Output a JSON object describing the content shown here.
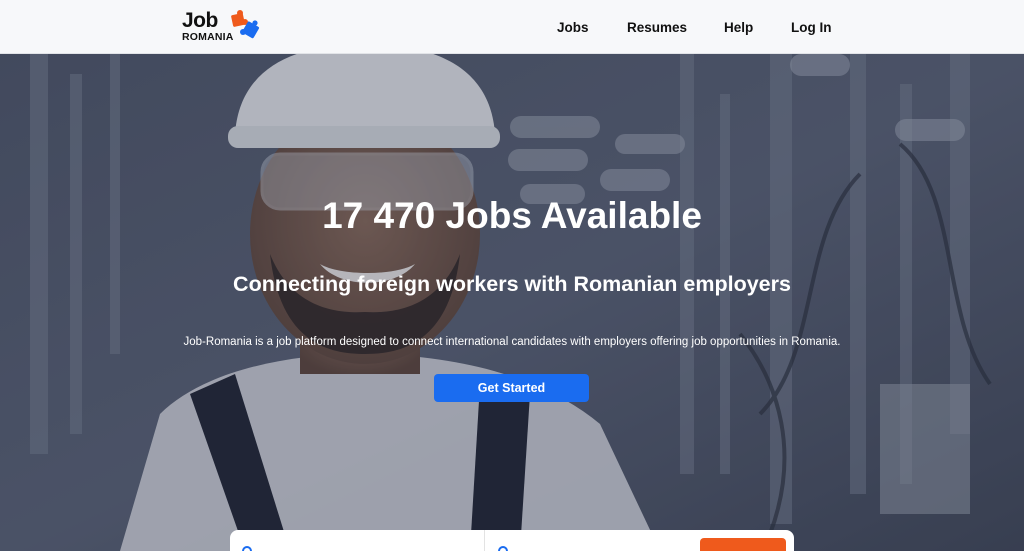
{
  "brand": {
    "name_top": "Job",
    "name_bottom": "ROMANIA",
    "colors": {
      "orange": "#ef5a1c",
      "blue": "#1a6cf0"
    }
  },
  "nav": {
    "items": [
      {
        "label": "Jobs"
      },
      {
        "label": "Resumes"
      },
      {
        "label": "Help"
      },
      {
        "label": "Log In"
      }
    ]
  },
  "hero": {
    "title": "17 470 Jobs Available",
    "subtitle": "Connecting foreign workers with Romanian employers",
    "description": "Job-Romania is a job platform designed to connect international candidates with employers offering job opportunities in Romania.",
    "cta_label": "Get Started"
  },
  "search": {
    "icons": [
      "location-icon",
      "search-icon"
    ],
    "button_color": "#ef5a1c"
  }
}
